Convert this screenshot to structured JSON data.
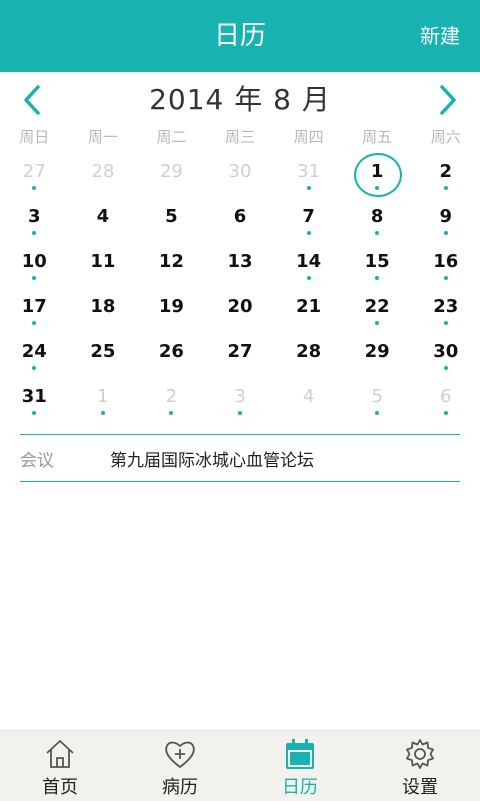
{
  "header": {
    "title": "日历",
    "new_label": "新建"
  },
  "calendar": {
    "month_label": "2014 年 8 月",
    "weekdays": [
      "周日",
      "周一",
      "周二",
      "周三",
      "周四",
      "周五",
      "周六"
    ],
    "weeks": [
      [
        {
          "d": "27",
          "m": true,
          "dot": true
        },
        {
          "d": "28",
          "m": true,
          "dot": false
        },
        {
          "d": "29",
          "m": true,
          "dot": false
        },
        {
          "d": "30",
          "m": true,
          "dot": false
        },
        {
          "d": "31",
          "m": true,
          "dot": true
        },
        {
          "d": "1",
          "m": false,
          "dot": true,
          "sel": true
        },
        {
          "d": "2",
          "m": false,
          "dot": true
        }
      ],
      [
        {
          "d": "3",
          "m": false,
          "dot": true
        },
        {
          "d": "4",
          "m": false,
          "dot": false
        },
        {
          "d": "5",
          "m": false,
          "dot": false
        },
        {
          "d": "6",
          "m": false,
          "dot": false
        },
        {
          "d": "7",
          "m": false,
          "dot": true
        },
        {
          "d": "8",
          "m": false,
          "dot": true
        },
        {
          "d": "9",
          "m": false,
          "dot": true
        }
      ],
      [
        {
          "d": "10",
          "m": false,
          "dot": true
        },
        {
          "d": "11",
          "m": false,
          "dot": false
        },
        {
          "d": "12",
          "m": false,
          "dot": false
        },
        {
          "d": "13",
          "m": false,
          "dot": false
        },
        {
          "d": "14",
          "m": false,
          "dot": true
        },
        {
          "d": "15",
          "m": false,
          "dot": true
        },
        {
          "d": "16",
          "m": false,
          "dot": true
        }
      ],
      [
        {
          "d": "17",
          "m": false,
          "dot": true
        },
        {
          "d": "18",
          "m": false,
          "dot": false
        },
        {
          "d": "19",
          "m": false,
          "dot": false
        },
        {
          "d": "20",
          "m": false,
          "dot": false
        },
        {
          "d": "21",
          "m": false,
          "dot": false
        },
        {
          "d": "22",
          "m": false,
          "dot": true
        },
        {
          "d": "23",
          "m": false,
          "dot": true
        }
      ],
      [
        {
          "d": "24",
          "m": false,
          "dot": true
        },
        {
          "d": "25",
          "m": false,
          "dot": false
        },
        {
          "d": "26",
          "m": false,
          "dot": false
        },
        {
          "d": "27",
          "m": false,
          "dot": false
        },
        {
          "d": "28",
          "m": false,
          "dot": false
        },
        {
          "d": "29",
          "m": false,
          "dot": false
        },
        {
          "d": "30",
          "m": false,
          "dot": true
        }
      ],
      [
        {
          "d": "31",
          "m": false,
          "dot": true
        },
        {
          "d": "1",
          "m": true,
          "dot": true
        },
        {
          "d": "2",
          "m": true,
          "dot": true
        },
        {
          "d": "3",
          "m": true,
          "dot": true
        },
        {
          "d": "4",
          "m": true,
          "dot": false
        },
        {
          "d": "5",
          "m": true,
          "dot": true
        },
        {
          "d": "6",
          "m": true,
          "dot": true
        }
      ]
    ]
  },
  "events": [
    {
      "type": "会议",
      "title": "第九届国际冰城心血管论坛"
    }
  ],
  "tabs": [
    {
      "label": "首页",
      "icon": "home-icon"
    },
    {
      "label": "病历",
      "icon": "heart-plus-icon"
    },
    {
      "label": "日历",
      "icon": "calendar-icon",
      "active": true
    },
    {
      "label": "设置",
      "icon": "gear-icon"
    }
  ],
  "colors": {
    "accent": "#16b3b1",
    "muted": "#cfcfcf",
    "tabbar": "#f2f1eb"
  }
}
